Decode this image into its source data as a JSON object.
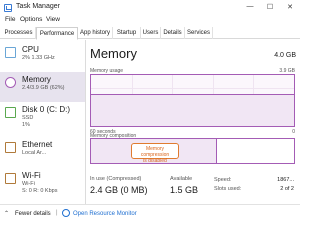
{
  "window": {
    "title": "Task Manager",
    "min_glyph": "—",
    "max_glyph": "☐",
    "close_glyph": "✕"
  },
  "menu": [
    "File",
    "Options",
    "View"
  ],
  "tabs": [
    "Processes",
    "Performance",
    "App history",
    "Startup",
    "Users",
    "Details",
    "Services"
  ],
  "active_tab": "Performance",
  "sidebar": [
    {
      "title": "CPU",
      "sub1": "2% 1.33 GHz",
      "sub2": ""
    },
    {
      "title": "Memory",
      "sub1": "2.4/3.9 GB (62%)",
      "sub2": ""
    },
    {
      "title": "Disk 0 (C: D:)",
      "sub1": "SSD",
      "sub2": "1%"
    },
    {
      "title": "Ethernet",
      "sub1": "Local Ar...",
      "sub2": ""
    },
    {
      "title": "Wi-Fi",
      "sub1": "Wi-Fi",
      "sub2": "S: 0 R: 0 Kbps"
    }
  ],
  "main": {
    "title": "Memory",
    "total": "4.0 GB",
    "usage_label": "Memory usage",
    "usage_max": "3.9 GB",
    "usage_fraction": 0.62,
    "time_label": "60 seconds",
    "time_end": "0",
    "composition_label": "Memory composition",
    "composition_used_fraction": 0.62,
    "callout_line1": "Memory compression",
    "callout_line2": "is disabled",
    "in_use_label": "In use (Compressed)",
    "in_use_value": "2.4 GB (0 MB)",
    "available_label": "Available",
    "available_value": "1.5 GB",
    "speed_label": "Speed:",
    "speed_value": "1867...",
    "slots_label": "Slots used:",
    "slots_value": "2 of 2"
  },
  "footer": {
    "chevron": "⌃",
    "fewer_details": "Fewer details",
    "separator": "|",
    "open_resource_monitor": "Open Resource Monitor"
  },
  "colors": {
    "accent_memory": "#a45cb5",
    "link": "#1f6fd1",
    "callout": "#e07b2f"
  }
}
